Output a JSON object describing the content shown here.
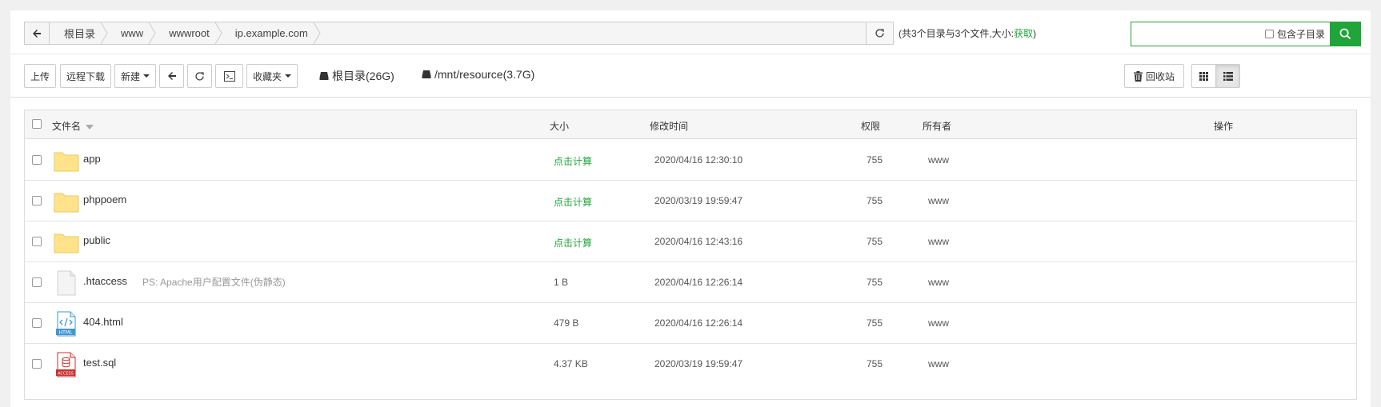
{
  "path": {
    "crumbs": [
      "根目录",
      "www",
      "wwwroot",
      "ip.example.com"
    ]
  },
  "summary": {
    "text": "(共3个目录与3个文件,大小:",
    "link": "获取",
    "close": ")"
  },
  "search": {
    "value": "",
    "placeholder": "",
    "include_sub_label": "包含子目录"
  },
  "toolbar": {
    "upload": "上传",
    "remote_download": "远程下载",
    "new": "新建",
    "favorites": "收藏夹",
    "disk_root": "根目录(26G)",
    "disk_mnt": "/mnt/resource(3.7G)",
    "recycle_bin": "回收站"
  },
  "table": {
    "headers": {
      "name": "文件名",
      "size": "大小",
      "mtime": "修改时间",
      "perm": "权限",
      "owner": "所有者",
      "ops": "操作"
    },
    "rows": [
      {
        "icon": "folder-icon",
        "name": "app",
        "note": "",
        "size": "点击计算",
        "size_link": true,
        "mtime": "2020/04/16 12:30:10",
        "perm": "755",
        "owner": "www"
      },
      {
        "icon": "folder-icon",
        "name": "phppoem",
        "note": "",
        "size": "点击计算",
        "size_link": true,
        "mtime": "2020/03/19 19:59:47",
        "perm": "755",
        "owner": "www"
      },
      {
        "icon": "folder-icon",
        "name": "public",
        "note": "",
        "size": "点击计算",
        "size_link": true,
        "mtime": "2020/04/16 12:43:16",
        "perm": "755",
        "owner": "www"
      },
      {
        "icon": "blank-file-icon",
        "name": ".htaccess",
        "note": "PS: Apache用户配置文件(伪静态)",
        "size": "1 B",
        "size_link": false,
        "mtime": "2020/04/16 12:26:14",
        "perm": "755",
        "owner": "www"
      },
      {
        "icon": "html-file-icon",
        "name": "404.html",
        "note": "",
        "size": "479 B",
        "size_link": false,
        "mtime": "2020/04/16 12:26:14",
        "perm": "755",
        "owner": "www"
      },
      {
        "icon": "sql-file-icon",
        "name": "test.sql",
        "note": "",
        "size": "4.37 KB",
        "size_link": false,
        "mtime": "2020/03/19 19:59:47",
        "perm": "755",
        "owner": "www"
      }
    ]
  },
  "colors": {
    "accent": "#20a53a",
    "folder": "#ffe38a",
    "border": "#dddddd"
  }
}
